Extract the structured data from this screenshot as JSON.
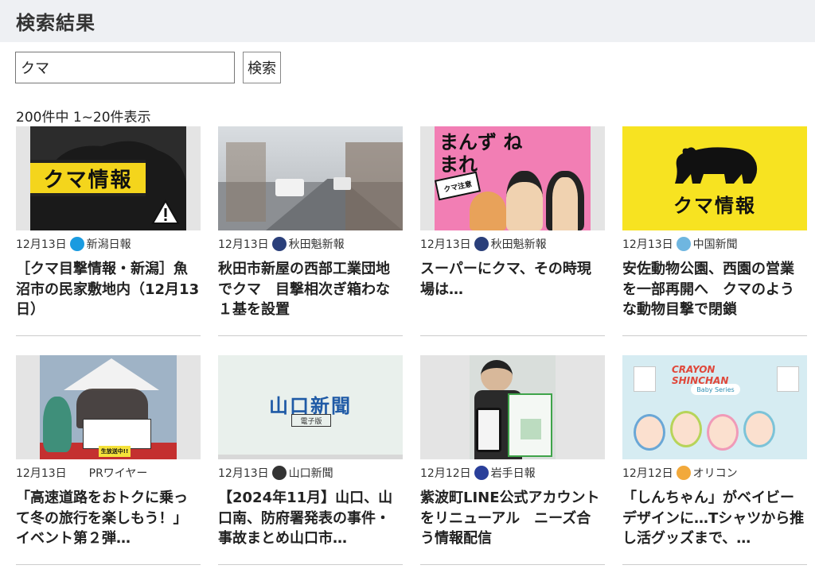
{
  "page": {
    "title": "検索結果"
  },
  "search": {
    "value": "クマ",
    "button_label": "検索"
  },
  "result_count": "200件中 1~20件表示",
  "articles": [
    {
      "date": "12月13日",
      "source": "新潟日報",
      "title": "［クマ目撃情報・新潟］魚沼市の民家敷地内（12月13日）",
      "thumb_text": "クマ情報",
      "icon_color": "#1a9be0"
    },
    {
      "date": "12月13日",
      "source": "秋田魁新報",
      "title": "秋田市新屋の西部工業団地でクマ　目撃相次ぎ箱わな１基を設置",
      "icon_color": "#2a3f7a"
    },
    {
      "date": "12月13日",
      "source": "秋田魁新報",
      "title": "スーパーにクマ、その時現場は…",
      "thumb_text": "まんず ねまれ",
      "thumb_sign": "クマ注意",
      "icon_color": "#2a3f7a"
    },
    {
      "date": "12月13日",
      "source": "中国新聞",
      "title": "安佐動物公園、西園の営業を一部再開へ　クマのような動物目撃で閉鎖",
      "thumb_text": "クマ情報",
      "icon_color": "#6fb6e0"
    },
    {
      "date": "12月13日",
      "source": "PRワイヤー",
      "title": "「高速道路をおトクに乗って冬の旅行を楽しもう！」 イベント第２弾…",
      "thumb_sign": "生放送中!!",
      "icon_color": ""
    },
    {
      "date": "12月13日",
      "source": "山口新聞",
      "title": "【2024年11月】山口、山口南、防府署発表の事件・事故まとめ山口市…",
      "thumb_text": "山口新聞",
      "thumb_sub": "電子版",
      "icon_color": "#333333"
    },
    {
      "date": "12月12日",
      "source": "岩手日報",
      "title": "紫波町LINE公式アカウントをリニューアル　ニーズ合う情報配信",
      "icon_color": "#2a3f9a"
    },
    {
      "date": "12月12日",
      "source": "オリコン",
      "title": "「しんちゃん」がベイビーデザインに…Tシャツから推し活グッズまで、…",
      "thumb_text": "CRAYON SHINCHAN",
      "thumb_sub": "Baby Series",
      "icon_color": "#f2a93b"
    }
  ]
}
